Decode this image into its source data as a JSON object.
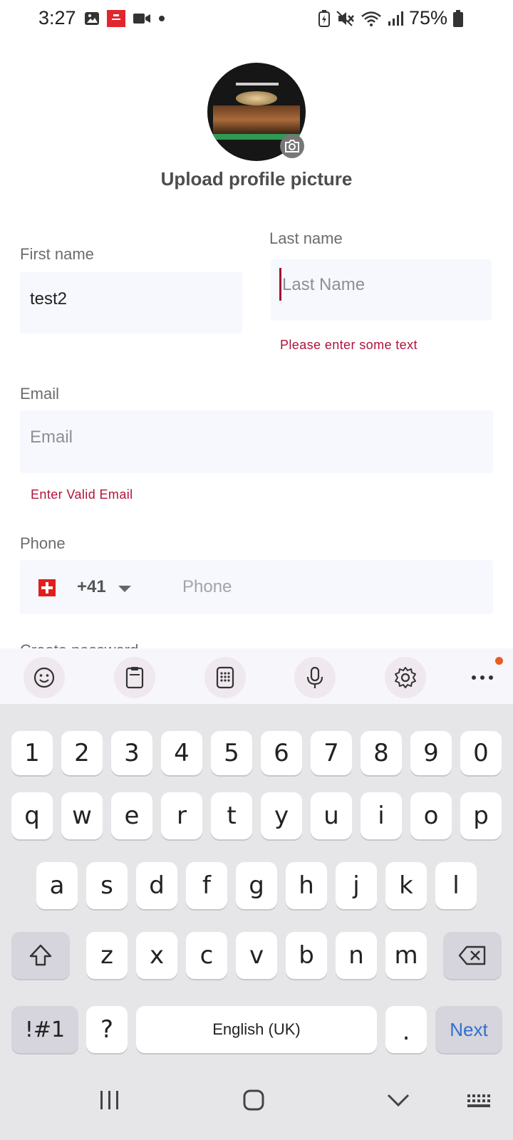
{
  "status_bar": {
    "time": "3:27",
    "battery": "75%"
  },
  "profile": {
    "upload_label": "Upload profile picture"
  },
  "form": {
    "first_name": {
      "label": "First name",
      "value": "test2"
    },
    "last_name": {
      "label": "Last name",
      "placeholder": "Last Name",
      "error": "Please enter some text"
    },
    "email": {
      "label": "Email",
      "placeholder": "Email",
      "error": "Enter Valid Email"
    },
    "phone": {
      "label": "Phone",
      "country_code": "+41",
      "placeholder": "Phone"
    },
    "password_label": "Create password"
  },
  "keyboard": {
    "toolbar_icons": [
      "emoji-icon",
      "clipboard-icon",
      "keypad-icon",
      "microphone-icon",
      "settings-icon",
      "more-icon"
    ],
    "row_numbers": [
      "1",
      "2",
      "3",
      "4",
      "5",
      "6",
      "7",
      "8",
      "9",
      "0"
    ],
    "row_1": [
      "q",
      "w",
      "e",
      "r",
      "t",
      "y",
      "u",
      "i",
      "o",
      "p"
    ],
    "row_2": [
      "a",
      "s",
      "d",
      "f",
      "g",
      "h",
      "j",
      "k",
      "l"
    ],
    "row_3": [
      "z",
      "x",
      "c",
      "v",
      "b",
      "n",
      "m"
    ],
    "symbols_label": "!#1",
    "question_label": "?",
    "space_label": "English (UK)",
    "period_label": ".",
    "next_label": "Next"
  },
  "colors": {
    "error": "#b0123b",
    "accent": "#2f6fd0",
    "field_bg": "#f7f8fd",
    "notification_dot": "#ea5b25"
  }
}
